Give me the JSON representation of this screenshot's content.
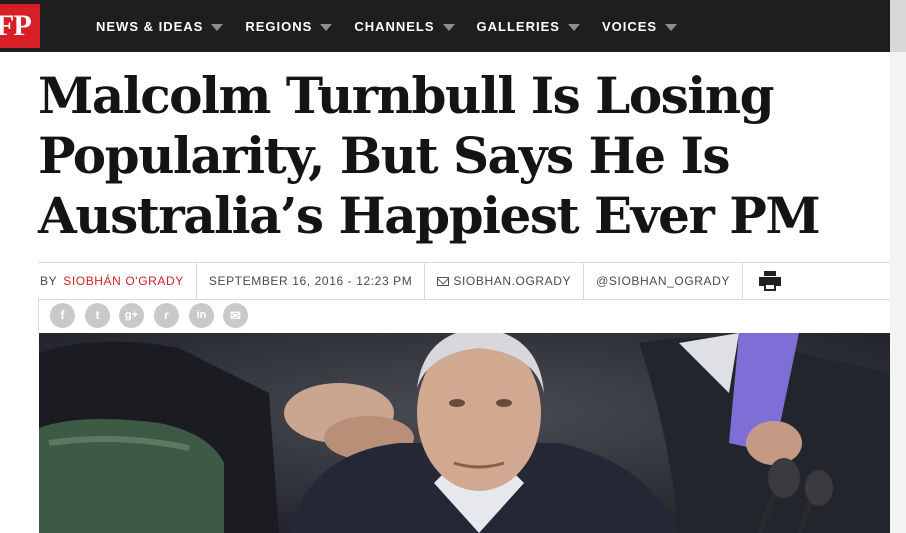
{
  "logo": {
    "text": "FP"
  },
  "nav": {
    "items": [
      {
        "label": "NEWS & IDEAS"
      },
      {
        "label": "REGIONS"
      },
      {
        "label": "CHANNELS"
      },
      {
        "label": "GALLERIES"
      },
      {
        "label": "VOICES"
      }
    ]
  },
  "article": {
    "headline": "Malcolm Turnbull Is Losing Popularity, But Says He Is Australia’s Happiest Ever PM",
    "by_prefix": "BY",
    "author": "SIOBHÁN O'GRADY",
    "date": "SEPTEMBER 16, 2016 - 12:23 PM",
    "email": "SIOBHAN.OGRADY",
    "twitter": "@SIOBHAN_OGRADY"
  },
  "share": {
    "icons": [
      {
        "name": "facebook-icon",
        "glyph": "f"
      },
      {
        "name": "twitter-icon",
        "glyph": "t"
      },
      {
        "name": "google-plus-icon",
        "glyph": "g+"
      },
      {
        "name": "reddit-icon",
        "glyph": "r"
      },
      {
        "name": "linkedin-icon",
        "glyph": "in"
      },
      {
        "name": "email-share-icon",
        "glyph": "✉"
      }
    ]
  },
  "colors": {
    "brand_red": "#d61f26",
    "nav_bg": "#1f1d1d"
  }
}
